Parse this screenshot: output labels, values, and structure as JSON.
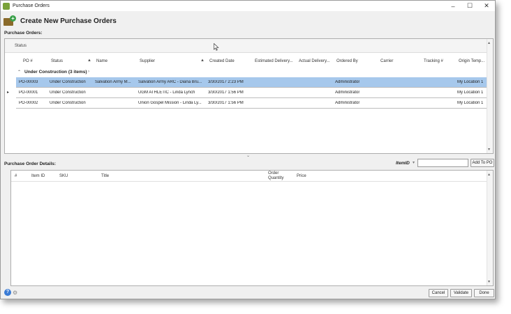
{
  "window": {
    "title": "Purchase Orders",
    "controls": {
      "minimize": "–",
      "maximize": "☐",
      "close": "✕"
    }
  },
  "header": {
    "title": "Create New Purchase Orders",
    "icon": "purchase-order-add-icon"
  },
  "orders": {
    "section_label": "Purchase Orders:",
    "group_panel_label": "Status",
    "columns": [
      "PO #",
      "Status",
      "Name",
      "Supplier",
      "Created Date",
      "Estimated Delivery...",
      "Actual Delivery...",
      "Ordered By",
      "Carrier",
      "Tracking #",
      "Origin Temp..."
    ],
    "sort_glyph": "▲",
    "group": {
      "chevron": "⌃",
      "label": "Under Construction (3 items)",
      "arrow": "›"
    },
    "rows": [
      {
        "po": "PO-00003",
        "status": "Under Construction",
        "name": "Salvation Army M...",
        "supplier": "Salvation Army ARC - Diana Bru...",
        "created": "3/30/2017 2:23 PM",
        "est": "",
        "actual": "",
        "ordered_by": "Administrator",
        "carrier": "",
        "tracking": "",
        "origin": "My Location 1"
      },
      {
        "po": "PO-00001",
        "status": "Under Construction",
        "name": "",
        "supplier": "UGM ATHLETIC - Linda Lynch",
        "created": "3/30/2017 1:56 PM",
        "est": "",
        "actual": "",
        "ordered_by": "Administrator",
        "carrier": "",
        "tracking": "",
        "origin": "My Location 1"
      },
      {
        "po": "PO-00002",
        "status": "Under Construction",
        "name": "",
        "supplier": "Union Gospel Mission - Linda Ly...",
        "created": "3/30/2017 1:56 PM",
        "est": "",
        "actual": "",
        "ordered_by": "Administrator",
        "carrier": "",
        "tracking": "",
        "origin": "My Location 1"
      }
    ],
    "selected_index": 0,
    "current_row_indicator": "▸"
  },
  "details": {
    "section_label": "Purchase Order Details:",
    "item_id_label": "ItemID",
    "item_id_caret": "▾",
    "item_id_value": "",
    "add_button": "Add To PO",
    "columns": [
      "#",
      "Item ID",
      "SKU",
      "Title",
      "Order\nQuantity",
      "Price"
    ]
  },
  "footer": {
    "help_glyph": "?",
    "settings_glyph": "⚙",
    "cancel": "Cancel",
    "validate": "Validate",
    "done": "Done"
  },
  "glyphs": {
    "scroll_up": "▴",
    "scroll_down": "▾",
    "splitter": "⌄"
  }
}
